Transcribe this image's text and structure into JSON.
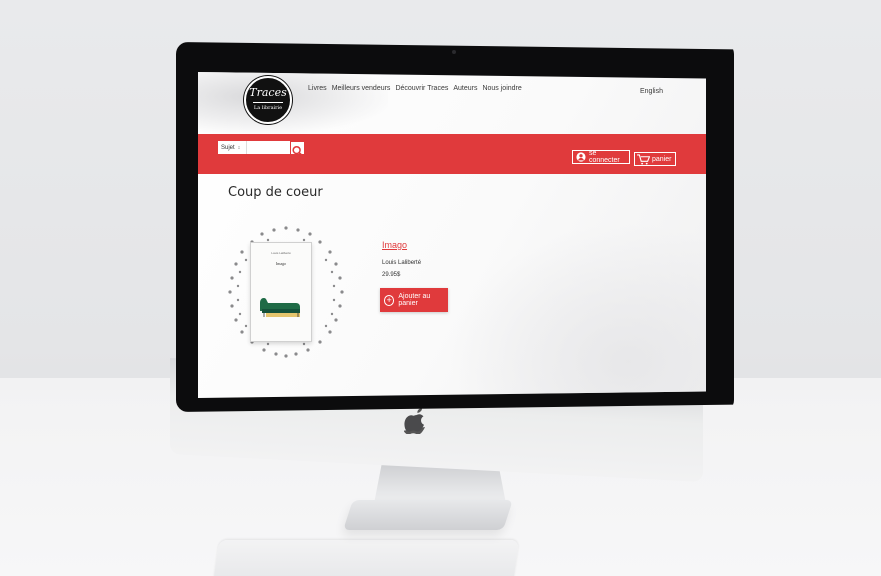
{
  "logo": {
    "title": "Traces",
    "subtitle": "La librairie"
  },
  "nav": {
    "items": [
      "Livres",
      "Meilleurs vendeurs",
      "Découvrir Traces",
      "Auteurs",
      "Nous joindre"
    ],
    "language": "English"
  },
  "search": {
    "select_label": "Sujet",
    "select_arrow": "↕"
  },
  "account": {
    "login_label": "se connecter",
    "cart_label": "panier"
  },
  "section": {
    "title": "Coup de coeur"
  },
  "product": {
    "title": "Imago",
    "author": "Louis Laliberté",
    "price": "29.95$",
    "add_to_cart_label": "Ajouter au panier",
    "cover_author": "Louis Laliberté",
    "cover_title": "Imago"
  },
  "colors": {
    "brand_red": "#e03a3c",
    "logo_black": "#111111"
  }
}
